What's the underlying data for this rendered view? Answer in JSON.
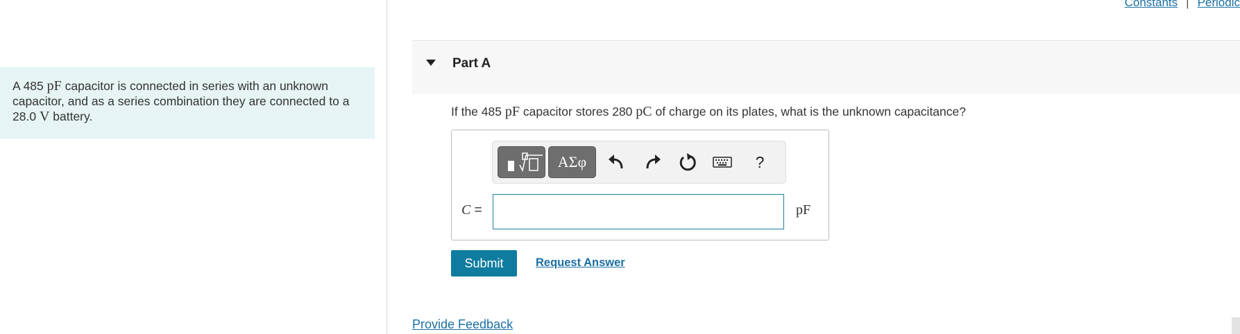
{
  "top_links": {
    "constants": "Constants",
    "separator": "|",
    "periodic": "Periodic"
  },
  "problem": {
    "prefix": "A 485 ",
    "unit1": "pF",
    "mid": " capacitor is connected in series with an unknown capacitor, and as a series combination they are connected to a 28.0 ",
    "unit2": "V",
    "suffix": " battery."
  },
  "part": {
    "title": "Part A"
  },
  "question": {
    "prefix": "If the 485 ",
    "unit1": "pF",
    "mid": " capacitor stores 280 ",
    "unit2": "pC",
    "suffix": " of charge on its plates, what is the unknown capacitance?"
  },
  "toolbar": {
    "greek_label": "ΑΣφ",
    "help_label": "?"
  },
  "answer": {
    "variable": "C",
    "equals": " =",
    "value": "",
    "unit": "pF"
  },
  "actions": {
    "submit": "Submit",
    "request_answer": "Request Answer",
    "provide_feedback": "Provide Feedback"
  },
  "colors": {
    "accent": "#0e7c9e",
    "problem_bg": "#e6f4f4",
    "link": "#1a6fa3"
  }
}
